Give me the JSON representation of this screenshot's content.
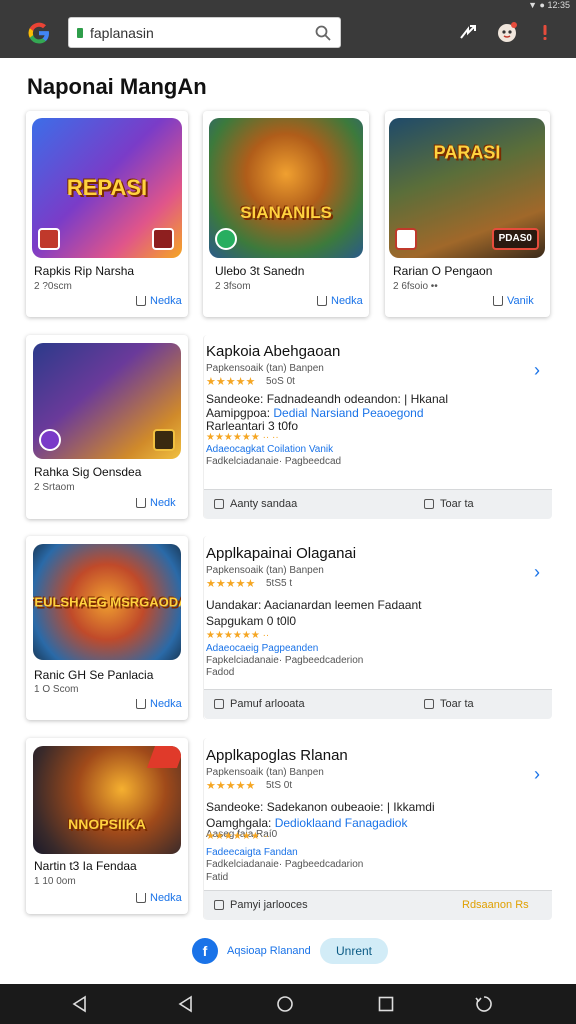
{
  "browser": {
    "status_icons": "▼ ● 12:35",
    "url": "faplanasin"
  },
  "page": {
    "title": "Naponai MangAn"
  },
  "top_cards": [
    {
      "art": "REPASI",
      "name": "Rapkis Rip Narsha",
      "sub": "2 ?0scm",
      "link": "Nedka"
    },
    {
      "art": "SIANANILS",
      "name": "Ulebo 3t Sanedn",
      "sub": "2 3fsom",
      "link": "Nedka"
    },
    {
      "art": "PARASI",
      "name": "Rarian O Pengaon",
      "sub": "2 6fsoio   ••",
      "link": "Vanik",
      "badge": "PDAS0"
    }
  ],
  "list_items": [
    {
      "thumb_name": "Rahka Sig Oensdea",
      "thumb_sub": "2 Srtaom",
      "thumb_link": "Nedk",
      "title": "Kapkoia Abehgaoan",
      "rating_line": "Papkensoaik (tan) Banpen",
      "stars": "★★★★★",
      "stars_sub": "5oS 0t",
      "line1": "Sandeoke: Fadnadeandh odeandon: | Hkanal",
      "line2a": "Aamipgpoa: ",
      "line2b": "Dedial Narsiand Peaoegond",
      "line3": "Rarleantari  3 t0fo",
      "tiny1": "★★★★★★  ·· ··",
      "blue1": "Adaeocagkat Coilation Vanik",
      "tiny2": "Fadkelciadanaie· Pagbeedcad",
      "bar_left": "Aanty sandaa",
      "bar_right": "Toar ta"
    },
    {
      "thumb_name": "Ranic GH Se Panlacia",
      "thumb_sub": "1 O Scom",
      "thumb_link": "Nedka",
      "thumb_art": "TEULSHAEG MSRGAODA",
      "title": "Applkapainai Olaganai",
      "rating_line": "Papkensoaik (tan) Banpen",
      "stars": "★★★★★",
      "stars_sub": "5tS5 t",
      "line1": "Uandakar: Aacianardan leemen Fadaant",
      "line2a": "Sapgukam  0 t0l0",
      "line2b": "",
      "line3": "",
      "tiny1": "★★★★★★  ··",
      "blue1": "Adaeocaeig Pagpeanden",
      "tiny2": "Fapkelciadanaie· Pagbeedcaderion",
      "tiny3": "Fadod",
      "bar_left": "Pamuf arlooata",
      "bar_right": "Toar ta"
    },
    {
      "thumb_name": "Nartin t3 Ia Fendaa",
      "thumb_sub": "1 10 0om",
      "thumb_link": "Nedka",
      "thumb_art": "NNOPSIIKA",
      "title": "Applkapoglas Rlanan",
      "rating_line": "Papkensoaik (tan) Banpen",
      "stars": "★★★★★",
      "stars_sub": "5tS 0t",
      "line1": "Sandeoke: Sadekanon oubeaoie: | Ikkamdi",
      "line2a": "Oamghgala: ",
      "line2b": "Dedioklaand Fanagadiok",
      "line3": "Aaseg faia  Raí0",
      "tiny1": "★★★★★★  ··",
      "blue1": "Fadeecaigta Fandan",
      "tiny2": "Fadkelciadanaie· Pagbeedcadarion",
      "tiny3": "Fatid",
      "bar_left": "Pamyi jarlooces",
      "bar_right": "Rdsaanon Rs"
    }
  ],
  "footer": {
    "fab_glyph": "f",
    "fab_label": "Aqsioap Rlanand",
    "pill_label": "Unrent"
  },
  "colors": {
    "accent": "#1a73e8",
    "star": "#f5a623",
    "topbar": "#3a3a3a"
  }
}
